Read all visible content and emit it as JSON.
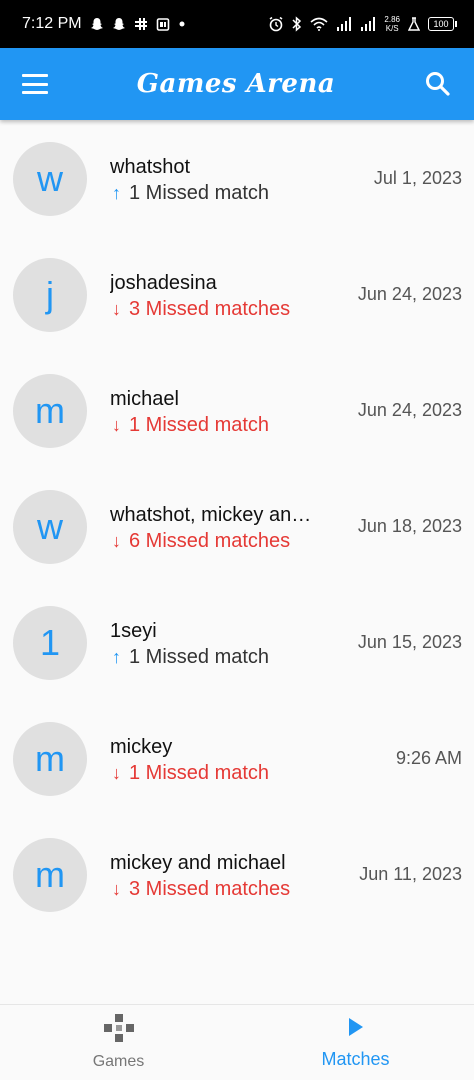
{
  "status_bar": {
    "time": "7:12 PM",
    "net_speed": "2.86",
    "net_unit": "K/S",
    "battery": "100",
    "icons": [
      "snapchat-icon",
      "snapchat-icon",
      "slack-icon",
      "calendar-icon",
      "dot-icon",
      "alarm-icon",
      "bluetooth-icon",
      "wifi-icon",
      "signal-icon",
      "signal-icon",
      "lab-icon"
    ]
  },
  "appbar": {
    "title": "Games Arena",
    "color": "#2196f3"
  },
  "matches": [
    {
      "initial": "w",
      "name": "whatshot",
      "direction": "up",
      "status": "1 Missed match",
      "date": "Jul 1, 2023"
    },
    {
      "initial": "j",
      "name": "joshadesina",
      "direction": "down",
      "status": "3 Missed matches",
      "date": "Jun 24, 2023"
    },
    {
      "initial": "m",
      "name": "michael",
      "direction": "down",
      "status": "1 Missed match",
      "date": "Jun 24, 2023"
    },
    {
      "initial": "w",
      "name": "whatshot, mickey and michael",
      "direction": "down",
      "status": "6 Missed matches",
      "date": "Jun 18, 2023"
    },
    {
      "initial": "1",
      "name": "1seyi",
      "direction": "up",
      "status": "1 Missed match",
      "date": "Jun 15, 2023"
    },
    {
      "initial": "m",
      "name": "mickey",
      "direction": "down",
      "status": "1 Missed match",
      "date": "9:26 AM"
    },
    {
      "initial": "m",
      "name": "mickey and michael",
      "direction": "down",
      "status": "3 Missed matches",
      "date": "Jun 11, 2023"
    }
  ],
  "bottom_nav": {
    "items": [
      {
        "label": "Games",
        "icon": "gamepad-icon",
        "active": false
      },
      {
        "label": "Matches",
        "icon": "play-icon",
        "active": true
      }
    ]
  },
  "colors": {
    "accent": "#2196f3",
    "missed_down": "#e53935",
    "avatar_bg": "#e0e0e0"
  }
}
